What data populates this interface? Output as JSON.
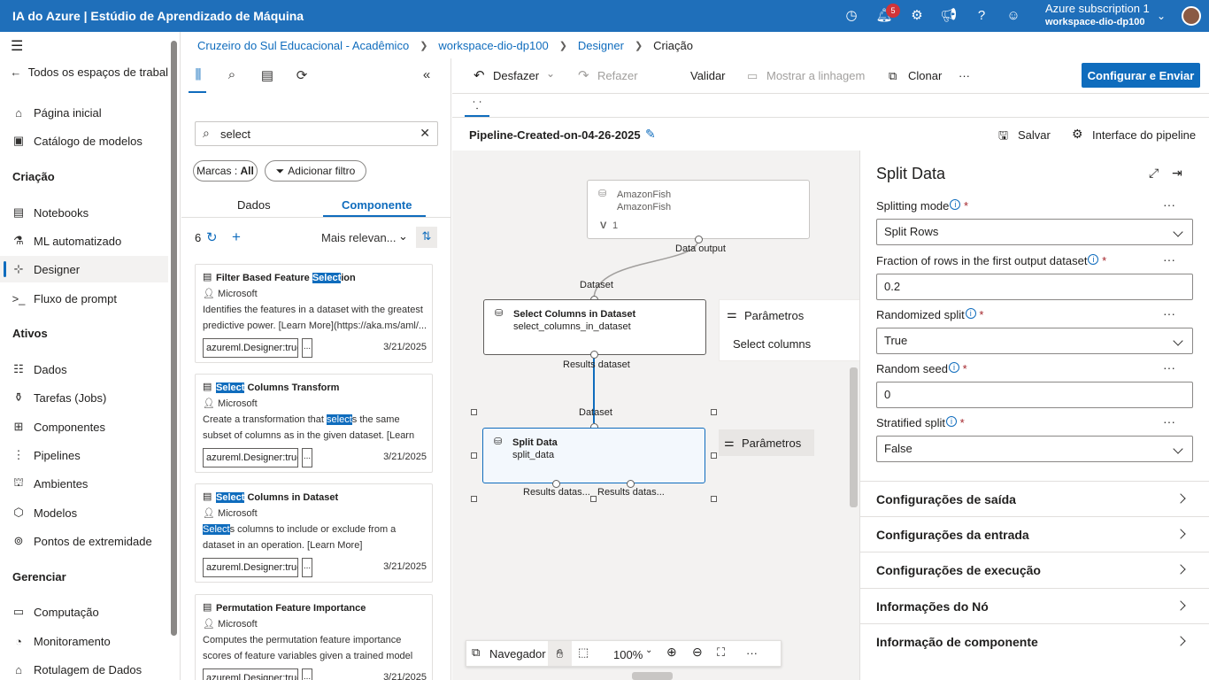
{
  "topbar": {
    "title": "IA do Azure | Estúdio de Aprendizado de Máquina",
    "notifications_count": "5",
    "subscription": "Azure subscription 1",
    "workspace": "workspace-dio-dp100",
    "icons": [
      "clock-icon",
      "bell-icon",
      "gear-icon",
      "megaphone-icon",
      "help-icon",
      "smiley-icon",
      "chevron-down-icon"
    ]
  },
  "nav": {
    "back": "Todos os espaços de trabal",
    "home": "Página inicial",
    "catalog": "Catálogo de modelos",
    "section_create": "Criação",
    "notebooks": "Notebooks",
    "automl": "ML automatizado",
    "designer": "Designer",
    "promptflow": "Fluxo de prompt",
    "section_assets": "Ativos",
    "data": "Dados",
    "jobs": "Tarefas (Jobs)",
    "components": "Componentes",
    "pipelines": "Pipelines",
    "environments": "Ambientes",
    "models": "Modelos",
    "endpoints": "Pontos de extremidade",
    "section_manage": "Gerenciar",
    "compute": "Computação",
    "monitoring": "Monitoramento",
    "labeling": "Rotulagem de Dados"
  },
  "breadcrumb": {
    "org": "Cruzeiro do Sul Educacional - Acadêmico",
    "workspace": "workspace-dio-dp100",
    "designer": "Designer",
    "current": "Criação"
  },
  "library": {
    "search_value": "select",
    "tags_label": "Marcas : ",
    "tags_value": "All",
    "add_filter": "Adicionar filtro",
    "tab_data": "Dados",
    "tab_component": "Componente",
    "count": "6",
    "sort": "Mais relevan...",
    "cards": [
      {
        "pre": "Filter Based Feature ",
        "hl": "Select",
        "post": "ion",
        "publisher": "Microsoft",
        "desc_pre": "Identifies the features in a dataset with the greatest predictive power. [Learn More](https://aka.ms/aml/...",
        "desc_hl": "",
        "desc_post": "",
        "tag": "azureml.Designer:true",
        "more": "...",
        "date": "3/21/2025"
      },
      {
        "pre": "",
        "hl": "Select",
        "post": " Columns Transform",
        "publisher": "Microsoft",
        "desc_pre": "Create a transformation that ",
        "desc_hl": "select",
        "desc_post": "s the same subset of columns as in the given dataset. [Learn More](htt...",
        "tag": "azureml.Designer:true",
        "more": "...",
        "date": "3/21/2025"
      },
      {
        "pre": "",
        "hl": "Select",
        "post": " Columns in Dataset",
        "publisher": "Microsoft",
        "desc_pre": "",
        "desc_hl": "Select",
        "desc_post": "s columns to include or exclude from a dataset in an operation. [Learn More](https://aka.ms/aml/s...",
        "tag": "azureml.Designer:true",
        "more": "...",
        "date": "3/21/2025"
      },
      {
        "pre": "Permutation Feature Importance",
        "hl": "",
        "post": "",
        "publisher": "Microsoft",
        "desc_pre": "Computes the permutation feature importance scores of feature variables given a trained model an...",
        "desc_hl": "",
        "desc_post": "",
        "tag": "azureml.Designer:true",
        "more": "...",
        "date": "3/21/2025"
      }
    ]
  },
  "toolbar": {
    "undo": "Desfazer",
    "redo": "Refazer",
    "validate": "Validar",
    "lineage": "Mostrar a linhagem",
    "clone": "Clonar",
    "submit": "Configurar e Enviar"
  },
  "pipeline": {
    "name": "Pipeline-Created-on-04-26-2025",
    "save": "Salvar",
    "interface": "Interface do pipeline"
  },
  "canvas": {
    "node1": {
      "title": "AmazonFish",
      "subtitle": "AmazonFish",
      "version": "V",
      "version_num": "1",
      "output": "Data output"
    },
    "node2": {
      "input": "Dataset",
      "title": "Select Columns in Dataset",
      "subtitle": "select_columns_in_dataset",
      "output": "Results dataset"
    },
    "node3": {
      "input": "Dataset",
      "title": "Split Data",
      "subtitle": "split_data",
      "output1": "Results datas...",
      "output2": "Results datas..."
    },
    "params_popup": {
      "title": "Parâmetros",
      "item": "Select columns"
    },
    "params_btn": "Parâmetros",
    "navigator": "Navegador",
    "zoom": "100%",
    "more": "···"
  },
  "panel": {
    "title": "Split Data",
    "fields": [
      {
        "label": "Splitting mode",
        "value": "Split Rows",
        "type": "select"
      },
      {
        "label": "Fraction of rows in the first output dataset",
        "value": "0.2",
        "type": "input"
      },
      {
        "label": "Randomized split",
        "value": "True",
        "type": "select"
      },
      {
        "label": "Random seed",
        "value": "0",
        "type": "input"
      },
      {
        "label": "Stratified split",
        "value": "False",
        "type": "select"
      }
    ],
    "required": "*",
    "sections": [
      "Configurações de saída",
      "Configurações da entrada",
      "Configurações de execução",
      "Informações do Nó",
      "Informação de componente"
    ]
  }
}
